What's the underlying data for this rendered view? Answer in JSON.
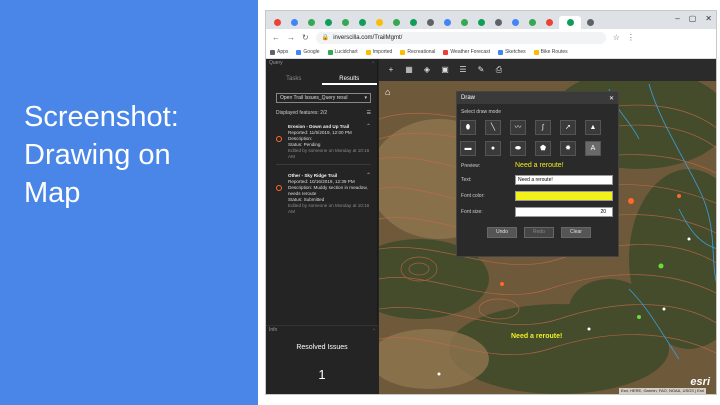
{
  "slide": {
    "title": "Screenshot:\nDrawing on\nMap",
    "background": "#4a86e8"
  },
  "browser": {
    "tab_count": 19,
    "url": "inverscilla.com/TrailMgmt/"
  },
  "query_panel": {
    "header": "Query",
    "tabs": [
      {
        "label": "Tasks",
        "active": false
      },
      {
        "label": "Results",
        "active": true
      }
    ],
    "selected_query": "Open Trail Issues_Query resul",
    "displayed_features": "Displayed features: 2/2",
    "results": [
      {
        "title": "Erosion - Down and Up Trail",
        "reported": "Reported: 11/5/2019, 12:00 PM",
        "description_label": "Description:",
        "status_label": "Status:",
        "status_value": "Pending",
        "edited": "Edited by someone on Monday at 10:16 AM"
      },
      {
        "title": "Other - Sky Ridge Trail",
        "reported": "Reported: 10/16/2019, 12:39 PM",
        "description_label": "Description:",
        "description_value": "Muddy section in meadow, needs reroute",
        "status_label": "Status:",
        "status_value": "Submitted",
        "edited": "Edited by someone on Monday at 10:16 AM"
      }
    ]
  },
  "info_panel": {
    "header": "Info",
    "title": "Resolved Issues",
    "count": "1"
  },
  "draw": {
    "title": "Draw",
    "mode_label": "Select draw mode",
    "tools": [
      {
        "icon": "point-icon",
        "glyph": "⬮",
        "active": false
      },
      {
        "icon": "line-icon",
        "glyph": "╲",
        "active": false
      },
      {
        "icon": "polyline-icon",
        "glyph": "〰",
        "active": false
      },
      {
        "icon": "freehand-line-icon",
        "glyph": "∫",
        "active": false
      },
      {
        "icon": "arrow-icon",
        "glyph": "➚",
        "active": false
      },
      {
        "icon": "triangle-icon",
        "glyph": "▲",
        "active": false
      },
      {
        "icon": "rectangle-icon",
        "glyph": "▬",
        "active": false
      },
      {
        "icon": "circle-icon",
        "glyph": "●",
        "active": false
      },
      {
        "icon": "ellipse-icon",
        "glyph": "⬬",
        "active": false
      },
      {
        "icon": "polygon-icon",
        "glyph": "⬟",
        "active": false
      },
      {
        "icon": "freehand-polygon-icon",
        "glyph": "✸",
        "active": false
      },
      {
        "icon": "text-icon",
        "glyph": "A",
        "active": true
      }
    ],
    "preview_label": "Preview:",
    "preview_text": "Need a reroute!",
    "text_label": "Text:",
    "text_value": "Need a reroute!",
    "font_color_label": "Font color:",
    "font_color": "#f2f21a",
    "font_size_label": "Font size:",
    "font_size": "20",
    "buttons": {
      "undo": "Undo",
      "redo": "Redo",
      "clear": "Clear"
    }
  },
  "map": {
    "label": "Need a reroute!",
    "logo": "esri",
    "attribution": "Esri, HERE, Garmin, FAO, NOAA, USGS | Esri"
  }
}
